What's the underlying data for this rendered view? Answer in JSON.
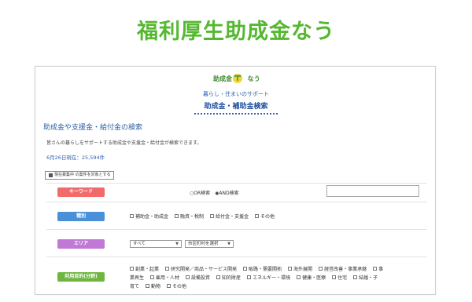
{
  "headline": "福利厚生助成金なう",
  "site": {
    "logo_text": "助成金",
    "logo_text2": "なう",
    "tagline": "暮らし・住まいのサポート",
    "title": "助成金・補助金検索"
  },
  "section": {
    "heading": "助成金や支援金・給付金の検索",
    "description": "皆さんの暮らしをサポートする助成金や支援金・給付金が検索できます。",
    "date_count": "6月26日現在：25,594件",
    "filter_label": "現在募集中 の案件を対象とする"
  },
  "keyword": {
    "label": "キーワード",
    "or_label": "○OR検索",
    "and_label": "◉AND検索",
    "input_value": ""
  },
  "category": {
    "label": "種別",
    "options": [
      "補助金・助成金",
      "融資・税制",
      "給付金・支援金",
      "その他"
    ]
  },
  "area": {
    "label": "エリア",
    "pref_value": "すべて",
    "city_value": "市区町村を選択"
  },
  "purpose": {
    "label": "利用目的(分野)",
    "line1": [
      "創業・起業",
      "研究開発／商品・サービス開発",
      "販路・需要開拓",
      "海外展開",
      "経営改善・事業承継",
      "事"
    ],
    "line2": [
      "業再生",
      "雇用・人材",
      "設備投資",
      "知的財産",
      "エネルギー・環境",
      "健康・医療",
      "住宅",
      "結婚・子"
    ],
    "line3": [
      "育て",
      "動物",
      "その他"
    ]
  },
  "colors": {
    "headline": "#55b830",
    "keyword_pill": "#f26b6b",
    "category_pill": "#4a90d9",
    "area_pill": "#c07ad6",
    "purpose_pill": "#6fb640",
    "link_blue": "#2f63b5"
  }
}
